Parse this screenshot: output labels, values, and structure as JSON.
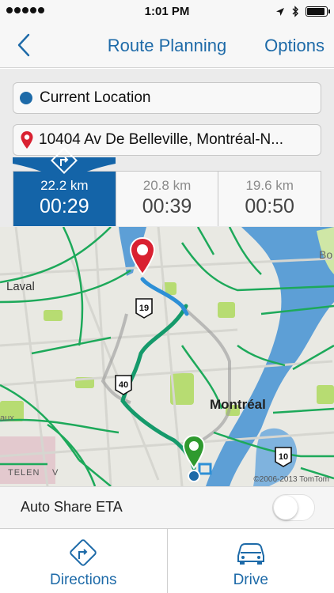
{
  "status_bar": {
    "time": "1:01 PM",
    "signal_dots": 5,
    "battery_level": 0.9
  },
  "nav": {
    "back_icon": "chevron-left-icon",
    "title": "Route Planning",
    "options_label": "Options"
  },
  "form": {
    "origin": "Current Location",
    "destination": "10404 Av De Belleville, Montréal-N..."
  },
  "routes": [
    {
      "distance": "22.2 km",
      "duration": "00:29",
      "active": true
    },
    {
      "distance": "20.8 km",
      "duration": "00:39",
      "active": false
    },
    {
      "distance": "19.6 km",
      "duration": "00:50",
      "active": false
    }
  ],
  "map": {
    "labels": {
      "laval": "Laval",
      "montreal": "Montréal",
      "bo": "Bo",
      "aux": "aux",
      "telen": "TELEN",
      "v": "V"
    },
    "highway_shields": [
      "19",
      "40",
      "10"
    ],
    "copyright": "©2006-2013 TomTom"
  },
  "auto_share": {
    "label": "Auto Share ETA",
    "enabled": false
  },
  "tabs": [
    {
      "label": "Directions",
      "icon": "directions-icon"
    },
    {
      "label": "Drive",
      "icon": "car-icon"
    }
  ],
  "colors": {
    "accent": "#1d6aa8",
    "active_route": "#1464a8",
    "route_line": "#159a6b",
    "destination_pin": "#d92131",
    "origin_pin": "#2f9a2f"
  }
}
